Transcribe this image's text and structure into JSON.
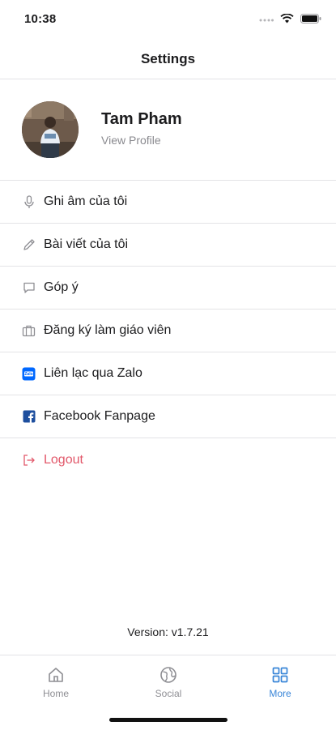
{
  "status_bar": {
    "time": "10:38",
    "signal_icon": "cellular-dots-icon",
    "wifi_icon": "wifi-icon",
    "battery_icon": "battery-icon"
  },
  "header": {
    "title": "Settings"
  },
  "profile": {
    "name": "Tam Pham",
    "link": "View Profile"
  },
  "menu": {
    "items": [
      {
        "label": "Ghi âm của tôi",
        "icon": "microphone-icon"
      },
      {
        "label": "Bài viết của tôi",
        "icon": "pencil-icon"
      },
      {
        "label": "Góp ý",
        "icon": "chat-bubble-icon"
      },
      {
        "label": "Đăng ký làm giáo viên",
        "icon": "briefcase-icon"
      },
      {
        "label": "Liên lạc qua Zalo",
        "icon": "zalo-icon"
      },
      {
        "label": "Facebook Fanpage",
        "icon": "facebook-icon"
      },
      {
        "label": "Logout",
        "icon": "logout-icon"
      }
    ]
  },
  "version": "Version: v1.7.21",
  "tab_bar": {
    "tabs": [
      {
        "label": "Home",
        "icon": "home-icon",
        "active": false
      },
      {
        "label": "Social",
        "icon": "globe-icon",
        "active": false
      },
      {
        "label": "More",
        "icon": "grid-icon",
        "active": true
      }
    ]
  },
  "colors": {
    "accent": "#3a86d8",
    "logout": "#e2586a",
    "zalo": "#0068ff",
    "facebook": "#1877f2"
  }
}
